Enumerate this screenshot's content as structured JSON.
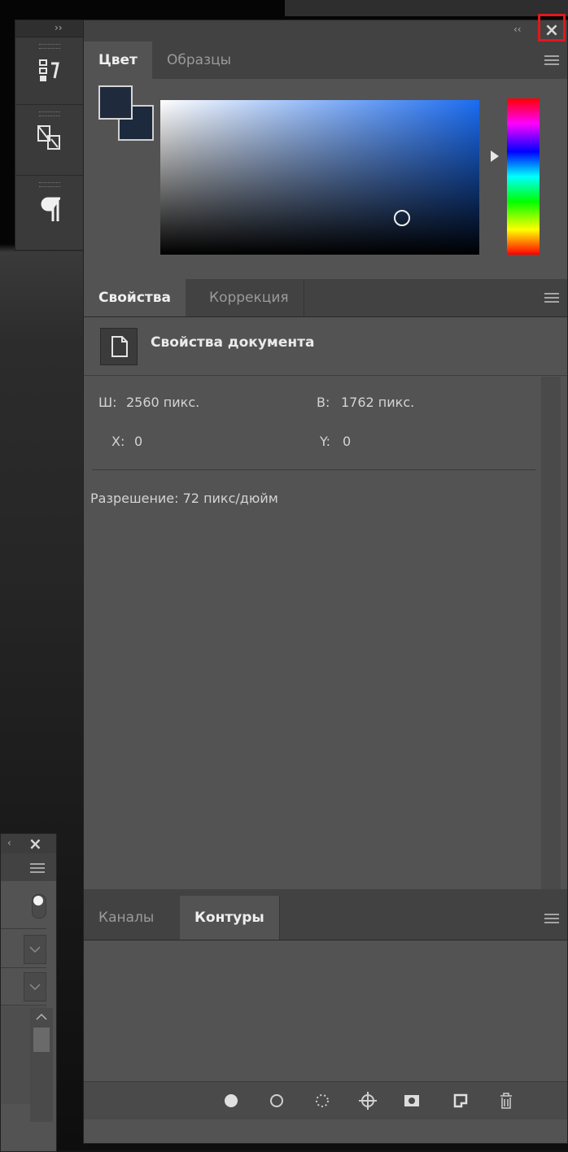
{
  "panels": {
    "color": {
      "tabs": [
        {
          "label": "Цвет",
          "active": true
        },
        {
          "label": "Образцы",
          "active": false
        }
      ],
      "foreground_color": "#1f2a3d",
      "background_color": "#1d2a3e",
      "picker_hue": "#1b6cf2"
    },
    "properties": {
      "tabs": [
        {
          "label": "Свойства",
          "active": true
        },
        {
          "label": "Коррекция",
          "active": false
        }
      ],
      "doc_title": "Свойства документа",
      "width_label": "Ш:",
      "width_value": "2560 пикс.",
      "height_label": "В:",
      "height_value": "1762 пикс.",
      "x_label": "X:",
      "x_value": "0",
      "y_label": "Y:",
      "y_value": "0",
      "resolution": "Разрешение: 72 пикс/дюйм"
    },
    "paths": {
      "tabs": [
        {
          "label": "Каналы",
          "active": false
        },
        {
          "label": "Контуры",
          "active": true
        }
      ],
      "footer_icons": [
        "fill-path-icon",
        "stroke-path-icon",
        "load-selection-icon",
        "make-path-icon",
        "add-mask-icon",
        "new-path-icon",
        "delete-icon"
      ]
    }
  },
  "chrome": {
    "expand_glyph": "››",
    "collapse_glyph": "‹‹",
    "close_glyph": "×",
    "left_collapse_glyph": "‹",
    "highlight_color": "#e0191d"
  }
}
